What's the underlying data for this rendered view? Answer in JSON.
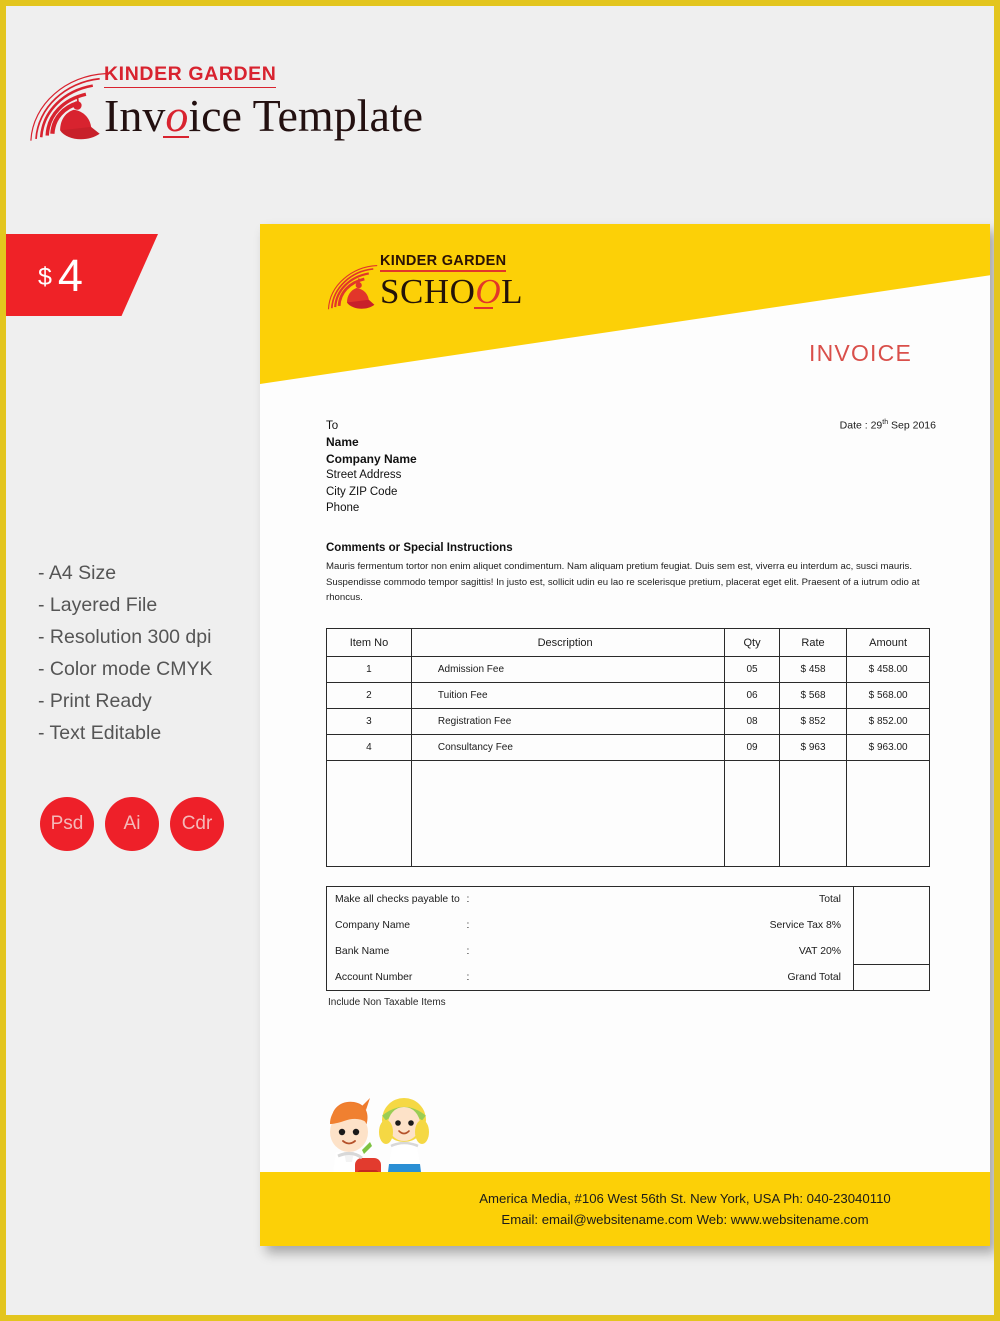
{
  "promo": {
    "brand_line": "KINDER GARDEN",
    "title_part1": "Inv",
    "title_o": "o",
    "title_part2": "ice Template",
    "price_currency": "$",
    "price_amount": "4",
    "features": [
      "- A4 Size",
      "- Layered File",
      "- Resolution 300 dpi",
      "- Color mode CMYK",
      "- Print Ready",
      "- Text Editable"
    ],
    "badges": [
      "Psd",
      "Ai",
      "Cdr"
    ],
    "accent_red": "#d8232f",
    "badge_red": "#ee2029"
  },
  "invoice": {
    "logo": {
      "kinder_garden": "KINDER GARDEN",
      "school_part1": "SCHO",
      "school_o": "O",
      "school_part2": "L"
    },
    "heading": "INVOICE",
    "date_prefix": "Date : 29",
    "date_sup": "th",
    "date_suffix": " Sep 2016",
    "banner_yellow": "#fcd007",
    "heading_red": "#d94f4a",
    "to": {
      "to_label": "To",
      "name": "Name",
      "company": "Company Name",
      "street": "Street Address",
      "city_zip": "City ZIP Code",
      "phone": "Phone"
    },
    "comments": {
      "heading": "Comments or Special Instructions",
      "body": "Mauris fermentum tortor non enim aliquet condimentum. Nam aliquam pretium feugiat. Duis sem est, viverra eu interdum ac, susci mauris. Suspendisse commodo tempor sagittis! In justo est, sollicit udin eu  lao re scelerisque pretium, placerat eget elit. Praesent of a iutrum odio at rhoncus."
    },
    "table": {
      "headers": [
        "Item No",
        "Description",
        "Qty",
        "Rate",
        "Amount"
      ],
      "rows": [
        {
          "item_no": "1",
          "description": "Admission Fee",
          "qty": "05",
          "rate": "$ 458",
          "amount": "$ 458.00"
        },
        {
          "item_no": "2",
          "description": "Tuition Fee",
          "qty": "06",
          "rate": "$ 568",
          "amount": "$ 568.00"
        },
        {
          "item_no": "3",
          "description": "Registration Fee",
          "qty": "08",
          "rate": "$ 852",
          "amount": "$ 852.00"
        },
        {
          "item_no": "4",
          "description": "Consultancy Fee",
          "qty": "09",
          "rate": "$ 963",
          "amount": "$ 963.00"
        }
      ]
    },
    "payment": {
      "rows": [
        {
          "label": "Make all checks payable to",
          "colon": ":",
          "value": ""
        },
        {
          "label": "Company Name",
          "colon": ":",
          "value": ""
        },
        {
          "label": "Bank Name",
          "colon": ":",
          "value": ""
        },
        {
          "label": "Account Number",
          "colon": ":",
          "value": ""
        }
      ],
      "summary": [
        {
          "label": "Total",
          "value": ""
        },
        {
          "label": "Service Tax 8%",
          "value": ""
        },
        {
          "label": "VAT 20%",
          "value": ""
        },
        {
          "label": "Grand Total",
          "value": ""
        }
      ]
    },
    "non_taxable_note": "Include Non Taxable Items",
    "footer": {
      "line1": "America Media, #106 West 56th St. New York, USA Ph: 040-23040110",
      "line2": "Email: email@websitename.com Web: www.websitename.com"
    }
  }
}
